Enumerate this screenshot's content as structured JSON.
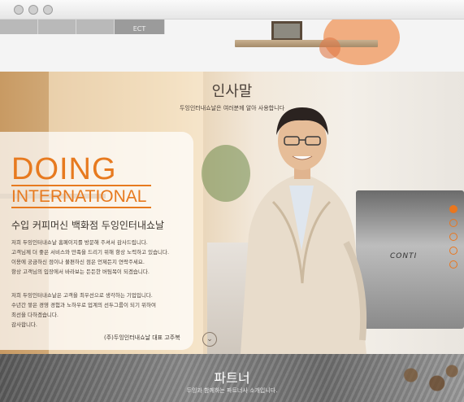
{
  "window": {
    "controls": [
      "close",
      "minimize",
      "zoom"
    ]
  },
  "top_nav": {
    "items": [
      "",
      "",
      "",
      "ECT"
    ]
  },
  "greeting": {
    "title": "인사말",
    "subtitle": "두잉인터내쇼날은 여러분께 알아 사용합니다"
  },
  "brand": {
    "line1": "DOING",
    "line2": "INTERNATIONAL",
    "tagline": "수입 커피머신 백화점 두잉인터내쇼날"
  },
  "message": {
    "para1": [
      "저희 두잉인터내쇼날 홈페이지를 방문해 주셔서 감사드립니다.",
      "고객님께 더 좋은 서비스와 만족을 드리기 위해 항상 노력하고 있습니다.",
      "이용에 궁금하신 점이나 불편하신 점은 언제든지 연락주세요.",
      "항상 고객님의 입장에서 바라보는 든든한 버팀목이 되겠습니다."
    ],
    "para2": [
      "저희 두잉인터내쇼날은 고객을 최우선으로 생각하는 기업입니다.",
      "수년간 쌓은 경영 경험과 노하우로 업계의 선두그룹이 되기 위하여",
      "최선을 다하겠습니다.",
      "감사합니다."
    ],
    "signature": "(주)두잉인터내쇼날 대표 고주복"
  },
  "machine_label": "CONTI",
  "slides": {
    "count": 5,
    "active": 1
  },
  "partner": {
    "title": "파트너",
    "subtitle": "두잉과 함께하는 파트너사 소개입니다."
  },
  "colors": {
    "accent": "#e77a1f"
  }
}
